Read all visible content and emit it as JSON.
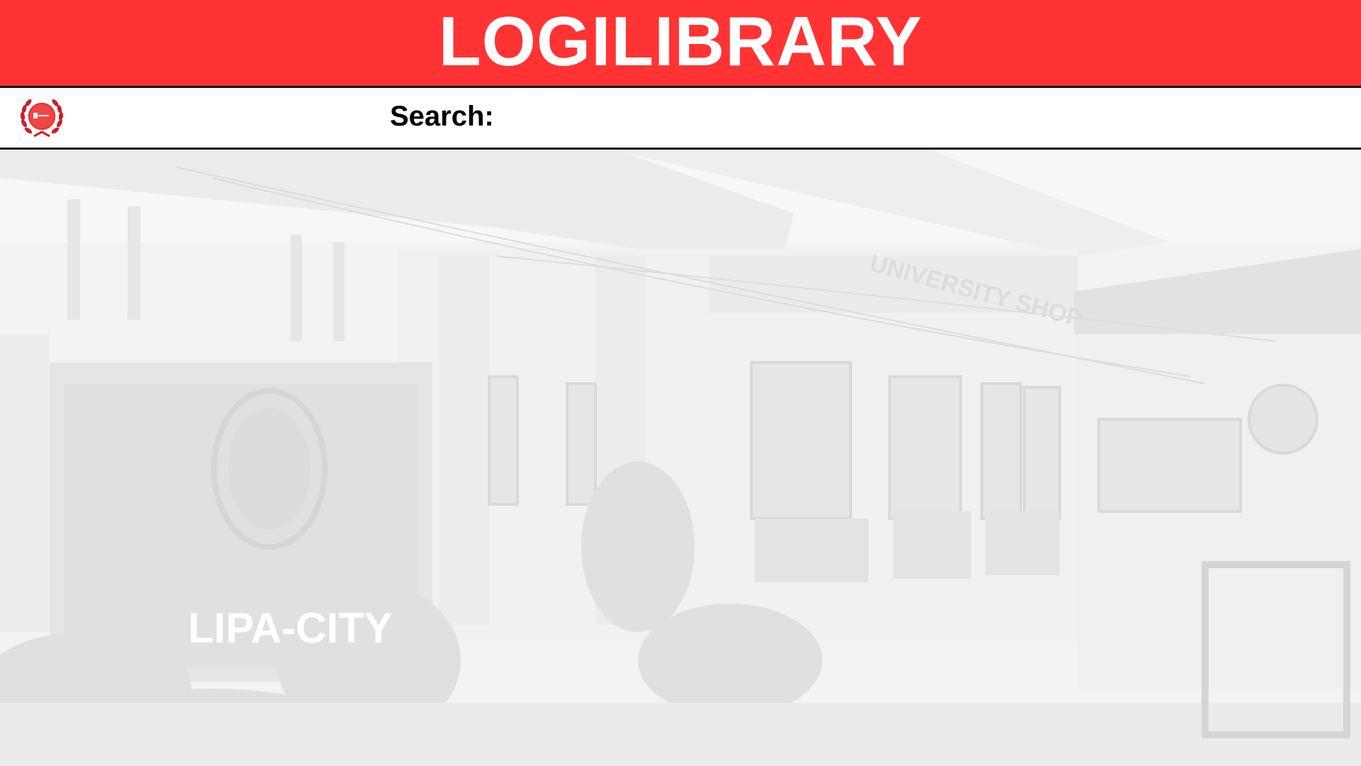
{
  "header": {
    "app_title": "LOGILIBRARY"
  },
  "toolbar": {
    "logo_icon": "university-seal-icon",
    "search_label": "Search:",
    "search_value": "",
    "search_placeholder": ""
  },
  "background": {
    "image_text": {
      "sign_shop": "UNIVERSITY SHOP",
      "sign_city": "LIPA-CITY"
    }
  },
  "colors": {
    "brand_red": "#ff3333",
    "divider": "#111111",
    "toolbar_bg": "#ffffff",
    "photo_tint": "#f2f2f2"
  }
}
